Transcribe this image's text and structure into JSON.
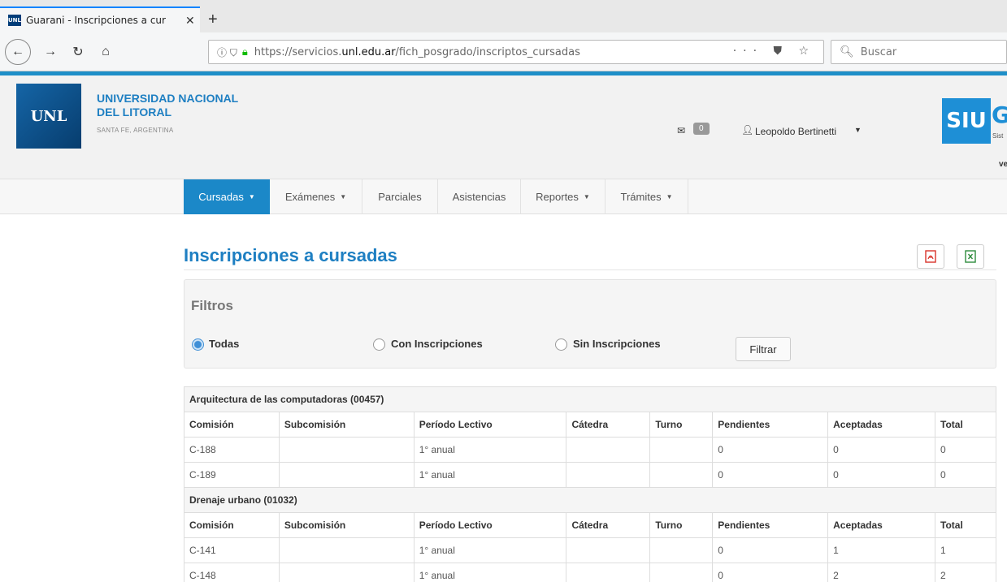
{
  "browser": {
    "tab_title": "Guarani - Inscripciones a cur",
    "tab_favicon": "UNL",
    "tab_close": "✕",
    "new_tab": "+",
    "url_prefix": "https://servicios.",
    "url_domain": "unl.edu.ar",
    "url_path": "/fich_posgrado/inscriptos_cursadas",
    "search_placeholder": "Buscar"
  },
  "header": {
    "logo_text": "UNL",
    "university_line1": "UNIVERSIDAD NACIONAL",
    "university_line2": "DEL LITORAL",
    "location": "SANTA FE, ARGENTINA",
    "messages_count": "0",
    "user_name": "Leopoldo Bertinetti",
    "siu_logo": "SIU",
    "siu_g": "G",
    "siu_sist": "Sist",
    "siu_ve": "ve"
  },
  "menu": [
    {
      "label": "Cursadas",
      "active": true,
      "dropdown": true
    },
    {
      "label": "Exámenes",
      "dropdown": true
    },
    {
      "label": "Parciales",
      "dropdown": false
    },
    {
      "label": "Asistencias",
      "dropdown": false
    },
    {
      "label": "Reportes",
      "dropdown": true
    },
    {
      "label": "Trámites",
      "dropdown": true
    }
  ],
  "page": {
    "title": "Inscripciones a cursadas"
  },
  "filters": {
    "title": "Filtros",
    "options": [
      "Todas",
      "Con Inscripciones",
      "Sin Inscripciones"
    ],
    "selected": "Todas",
    "button": "Filtrar"
  },
  "table": {
    "headers": [
      "Comisión",
      "Subcomisión",
      "Período Lectivo",
      "Cátedra",
      "Turno",
      "Pendientes",
      "Aceptadas",
      "Total"
    ],
    "groups": [
      {
        "name": "Arquitectura de las computadoras (00457)",
        "rows": [
          [
            "C-188",
            "",
            "1° anual",
            "",
            "",
            "0",
            "0",
            "0"
          ],
          [
            "C-189",
            "",
            "1° anual",
            "",
            "",
            "0",
            "0",
            "0"
          ]
        ]
      },
      {
        "name": "Drenaje urbano (01032)",
        "rows": [
          [
            "C-141",
            "",
            "1° anual",
            "",
            "",
            "0",
            "1",
            "1"
          ],
          [
            "C-148",
            "",
            "1° anual",
            "",
            "",
            "0",
            "2",
            "2"
          ]
        ]
      }
    ]
  },
  "colors": {
    "brand_blue": "#1e7fc2",
    "menu_active": "#1b88c8",
    "pdf_red": "#d9342b",
    "xls_green": "#2e8b3d"
  }
}
